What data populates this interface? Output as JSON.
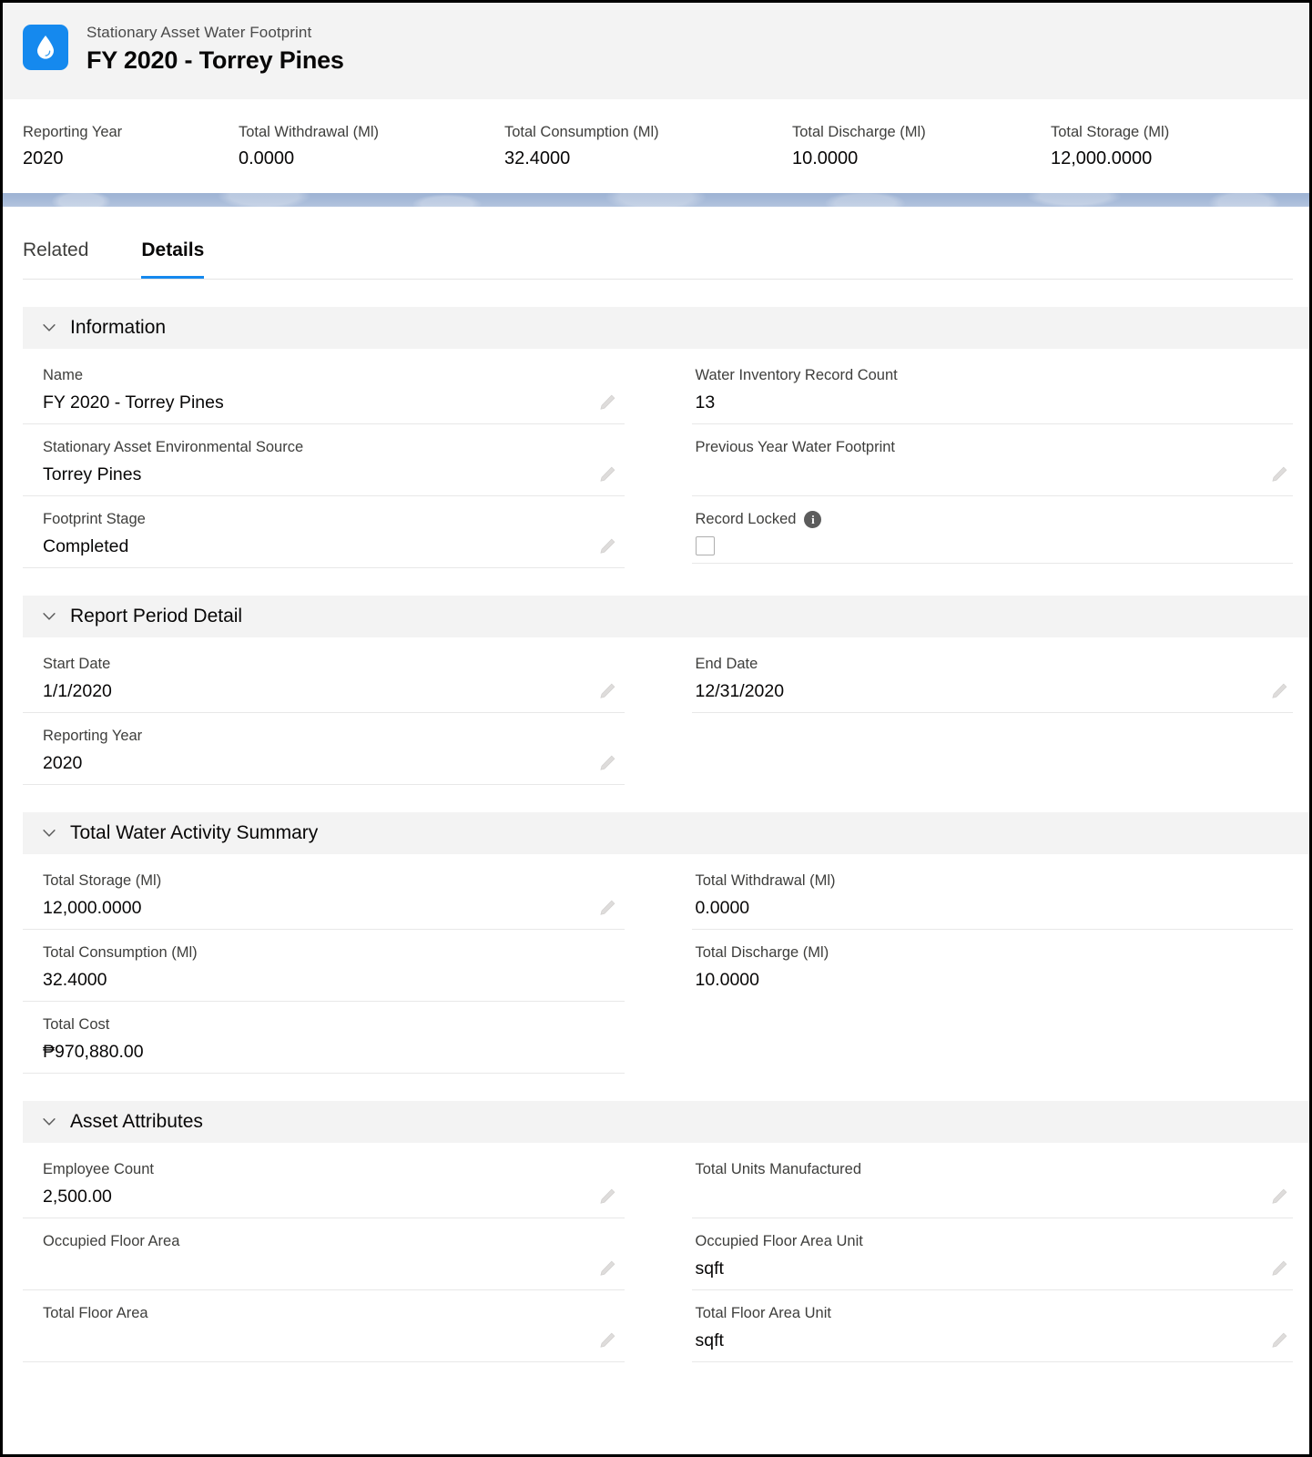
{
  "header": {
    "app_icon": "water-drop-icon",
    "eyebrow": "Stationary Asset Water Footprint",
    "title": "FY 2020 - Torrey Pines",
    "brand_color": "#1589ee"
  },
  "highlights": [
    {
      "label": "Reporting Year",
      "value": "2020"
    },
    {
      "label": "Total Withdrawal (Ml)",
      "value": "0.0000"
    },
    {
      "label": "Total Consumption (Ml)",
      "value": "32.4000"
    },
    {
      "label": "Total Discharge (Ml)",
      "value": "10.0000"
    },
    {
      "label": "Total Storage (Ml)",
      "value": "12,000.0000"
    }
  ],
  "tabs": [
    {
      "label": "Related",
      "active": false
    },
    {
      "label": "Details",
      "active": true
    }
  ],
  "sections": {
    "information": {
      "title": "Information",
      "left": [
        {
          "label": "Name",
          "value": "FY 2020 - Torrey Pines"
        },
        {
          "label": "Stationary Asset Environmental Source",
          "value": "Torrey Pines"
        },
        {
          "label": "Footprint Stage",
          "value": "Completed"
        }
      ],
      "right": [
        {
          "label": "Water Inventory Record Count",
          "value": "13"
        },
        {
          "label": "Previous Year Water Footprint",
          "value": ""
        },
        {
          "label": "Record Locked",
          "value": ""
        }
      ]
    },
    "report_period_detail": {
      "title": "Report Period Detail",
      "left": [
        {
          "label": "Start Date",
          "value": "1/1/2020"
        },
        {
          "label": "Reporting Year",
          "value": "2020"
        }
      ],
      "right": [
        {
          "label": "End Date",
          "value": "12/31/2020"
        }
      ]
    },
    "total_water_activity_summary": {
      "title": "Total Water Activity Summary",
      "left": [
        {
          "label": "Total Storage (Ml)",
          "value": "12,000.0000"
        },
        {
          "label": "Total Consumption (Ml)",
          "value": "32.4000"
        },
        {
          "label": "Total Cost",
          "value": "₱970,880.00"
        }
      ],
      "right": [
        {
          "label": "Total Withdrawal (Ml)",
          "value": "0.0000"
        },
        {
          "label": "Total Discharge (Ml)",
          "value": "10.0000"
        }
      ]
    },
    "asset_attributes": {
      "title": "Asset Attributes",
      "left": [
        {
          "label": "Employee Count",
          "value": "2,500.00"
        },
        {
          "label": "Occupied Floor Area",
          "value": ""
        },
        {
          "label": "Total Floor Area",
          "value": ""
        }
      ],
      "right": [
        {
          "label": "Total Units Manufactured",
          "value": ""
        },
        {
          "label": "Occupied Floor Area Unit",
          "value": "sqft"
        },
        {
          "label": "Total Floor Area Unit",
          "value": "sqft"
        }
      ]
    }
  }
}
